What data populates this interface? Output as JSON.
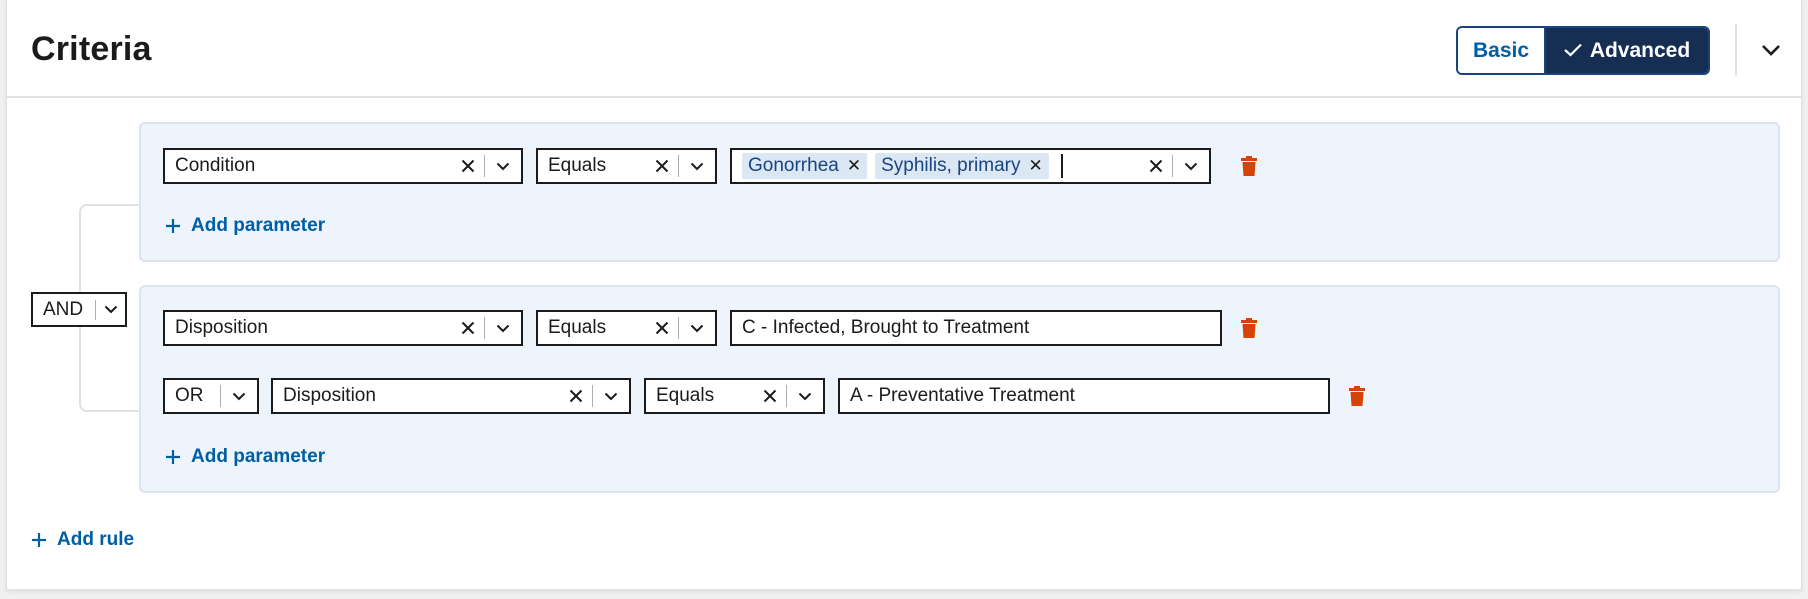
{
  "header": {
    "title": "Criteria",
    "toggle": {
      "basic_label": "Basic",
      "advanced_label": "Advanced",
      "selected": "Advanced"
    }
  },
  "root": {
    "operator": "AND"
  },
  "groups": [
    {
      "rows": [
        {
          "field": "Condition",
          "operator": "Equals",
          "values": [
            "Gonorrhea",
            "Syphilis, primary"
          ]
        }
      ],
      "add_parameter": "Add parameter"
    },
    {
      "rows": [
        {
          "field": "Disposition",
          "operator": "Equals",
          "value": "C - Infected, Brought to Treatment"
        },
        {
          "connector": "OR",
          "field": "Disposition",
          "operator": "Equals",
          "value": "A - Preventative Treatment"
        }
      ],
      "add_parameter": "Add parameter"
    }
  ],
  "add_rule": "Add rule",
  "colors": {
    "accent": "#005ea2",
    "dark_accent": "#162e51",
    "danger": "#d54309",
    "group_bg": "#eef4fb",
    "chip_bg": "#dce7f4"
  },
  "icons": {
    "check": "check-icon",
    "chevron": "chevron-down-icon",
    "clear": "close-icon",
    "delete": "trash-icon",
    "add": "plus-icon"
  }
}
